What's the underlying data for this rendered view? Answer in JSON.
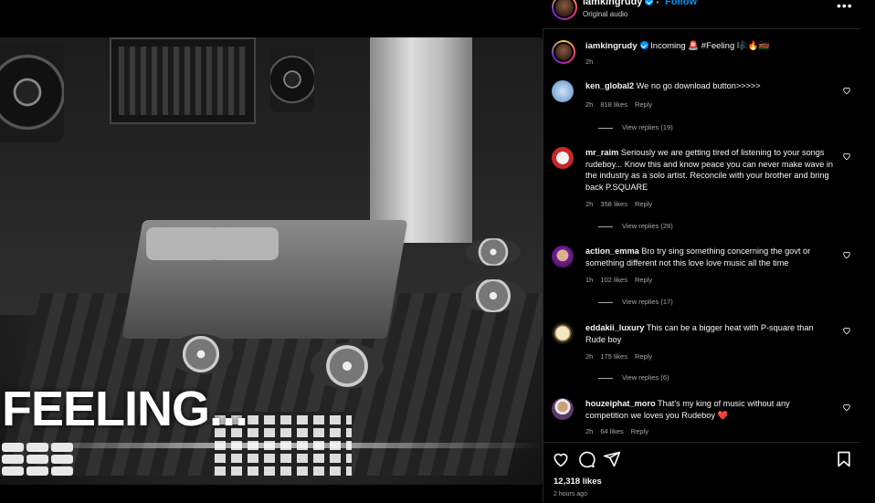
{
  "header": {
    "username": "iamkingrudy",
    "separator": "•",
    "follow_label": "Follow",
    "audio": "Original audio",
    "more_label": "•••"
  },
  "media": {
    "overlay_text": "FEELING...",
    "mute_icon": "speaker-muted-icon"
  },
  "caption": {
    "username": "iamkingrudy",
    "text": "Incoming 🚨 #Feeling 🎼🔥🇰🇪",
    "time": "2h"
  },
  "comments": [
    {
      "username": "ken_global2",
      "text": "We no go download button>>>>>",
      "time": "2h",
      "likes": "818 likes",
      "reply": "Reply",
      "view_replies": "View replies (19)"
    },
    {
      "username": "mr_raim",
      "text": "Seriously we are getting tired of listening to your songs rudeboy... Know this and know peace you can never make wave in the industry as a solo artist. Reconcile with your brother and bring back P.SQUARE",
      "time": "2h",
      "likes": "358 likes",
      "reply": "Reply",
      "view_replies": "View replies (28)"
    },
    {
      "username": "action_emma",
      "text": "Bro try sing something concerning the govt or something different not this love love music all the time",
      "time": "1h",
      "likes": "102 likes",
      "reply": "Reply",
      "view_replies": "View replies (17)"
    },
    {
      "username": "eddakii_luxury",
      "text": "This can be a bigger heat with P-square than Rude boy",
      "time": "2h",
      "likes": "175 likes",
      "reply": "Reply",
      "view_replies": "View replies (6)"
    },
    {
      "username": "houzeiphat_moro",
      "text": "That's my king of music without any competition we loves you Rudeboy ❤️",
      "time": "2h",
      "likes": "64 likes",
      "reply": "Reply",
      "view_replies": ""
    }
  ],
  "footer": {
    "likes": "12,318 likes",
    "posted": "2 hours ago"
  },
  "colors": {
    "background": "#000000",
    "text": "#f5f5f5",
    "muted": "#a8a8a8",
    "accent": "#0095f6"
  }
}
